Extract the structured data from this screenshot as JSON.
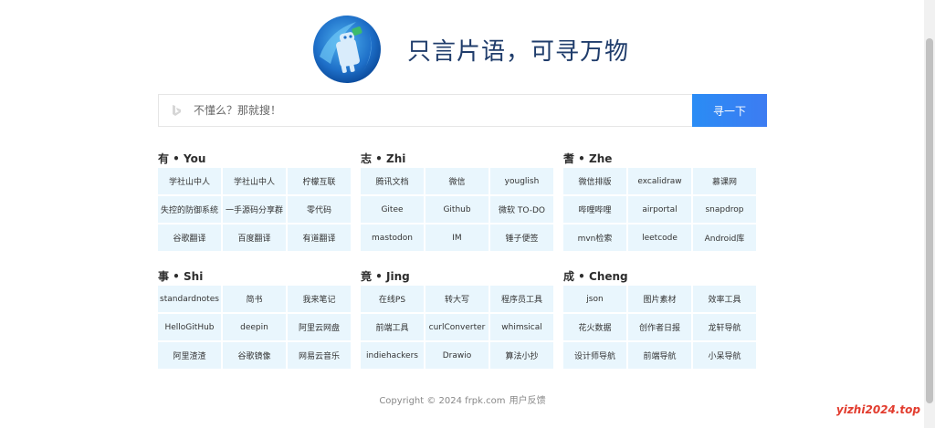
{
  "header": {
    "slogan": "只言片语，可寻万物",
    "logo_icon": "android-robot-logo-icon"
  },
  "search": {
    "engine_icon": "bing-icon",
    "placeholder": "不懂么？那就搜！",
    "button_label": "寻一下"
  },
  "sections": [
    {
      "title": "有 • You",
      "links": [
        "学社山中人",
        "学社山中人",
        "柠檬互联",
        "失控的防御系统",
        "一手源码分享群",
        "零代码",
        "谷歌翻译",
        "百度翻译",
        "有道翻译"
      ]
    },
    {
      "title": "志 • Zhi",
      "links": [
        "腾讯文档",
        "微信",
        "youglish",
        "Gitee",
        "Github",
        "微软 TO-DO",
        "mastodon",
        "IM",
        "锤子便签"
      ]
    },
    {
      "title": "耆 • Zhe",
      "links": [
        "微信排版",
        "excalidraw",
        "慕课网",
        "哔哩哔哩",
        "airportal",
        "snapdrop",
        "mvn检索",
        "leetcode",
        "Android库"
      ]
    },
    {
      "title": "事 • Shi",
      "links": [
        "standardnotes",
        "简书",
        "我来笔记",
        "HelloGitHub",
        "deepin",
        "阿里云网盘",
        "阿里渣渣",
        "谷歌镜像",
        "网易云音乐"
      ]
    },
    {
      "title": "竟 • Jing",
      "links": [
        "在线PS",
        "转大写",
        "程序员工具",
        "前端工具",
        "curlConverter",
        "whimsical",
        "indiehackers",
        "Drawio",
        "算法小抄"
      ]
    },
    {
      "title": "成 • Cheng",
      "links": [
        "json",
        "图片素材",
        "效率工具",
        "花火数据",
        "创作者日报",
        "龙轩导航",
        "设计师导航",
        "前端导航",
        "小呆导航"
      ]
    }
  ],
  "footer": {
    "copyright": "Copyright © 2024 frpk.com",
    "feedback": "用户反馈"
  },
  "watermark": "yizhi2024.top",
  "colors": {
    "accent": "#2a8cf5",
    "cell_bg": "#e9f6fd",
    "slogan": "#1f3c6b",
    "watermark": "#e23c2e"
  }
}
